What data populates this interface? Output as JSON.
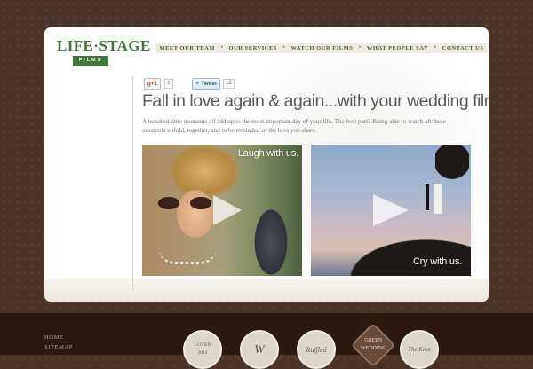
{
  "brand": {
    "name": "LIFE·STAGE",
    "tagline": "FILMS",
    "color": "#3d7a34"
  },
  "nav": {
    "items": [
      {
        "label": "MEET OUR TEAM"
      },
      {
        "label": "OUR SERVICES"
      },
      {
        "label": "WATCH OUR FILMS"
      },
      {
        "label": "WHAT PEOPLE SAY"
      },
      {
        "label": "CONTACT US"
      }
    ],
    "separator": "•"
  },
  "social": {
    "gplus_label": "g+1",
    "gplus_count": "5",
    "tweet_label": "Tweet",
    "tweet_count": "12"
  },
  "main": {
    "headline": "Fall in love again & again...with your wedding film.",
    "description": "A hundred little moments all add up to the most important day of your life. The best part? Being able to watch all these moments unfold, together, and to be reminded of the love you share."
  },
  "videos": [
    {
      "caption": "Laugh with us."
    },
    {
      "caption": "Cry with us."
    }
  ],
  "footer": {
    "links": [
      "HOME",
      "SITEMAP"
    ],
    "badges": [
      {
        "text": "LOVED\n2014"
      },
      {
        "text": "W"
      },
      {
        "text": "Ruffled"
      },
      {
        "text": "GREEN\nWEDDING"
      },
      {
        "text": "The Knot"
      }
    ]
  },
  "colors": {
    "background": "#4a3327",
    "footer": "#2b1810",
    "nav_text": "#4d5b34",
    "headline": "#5a5a5a"
  }
}
